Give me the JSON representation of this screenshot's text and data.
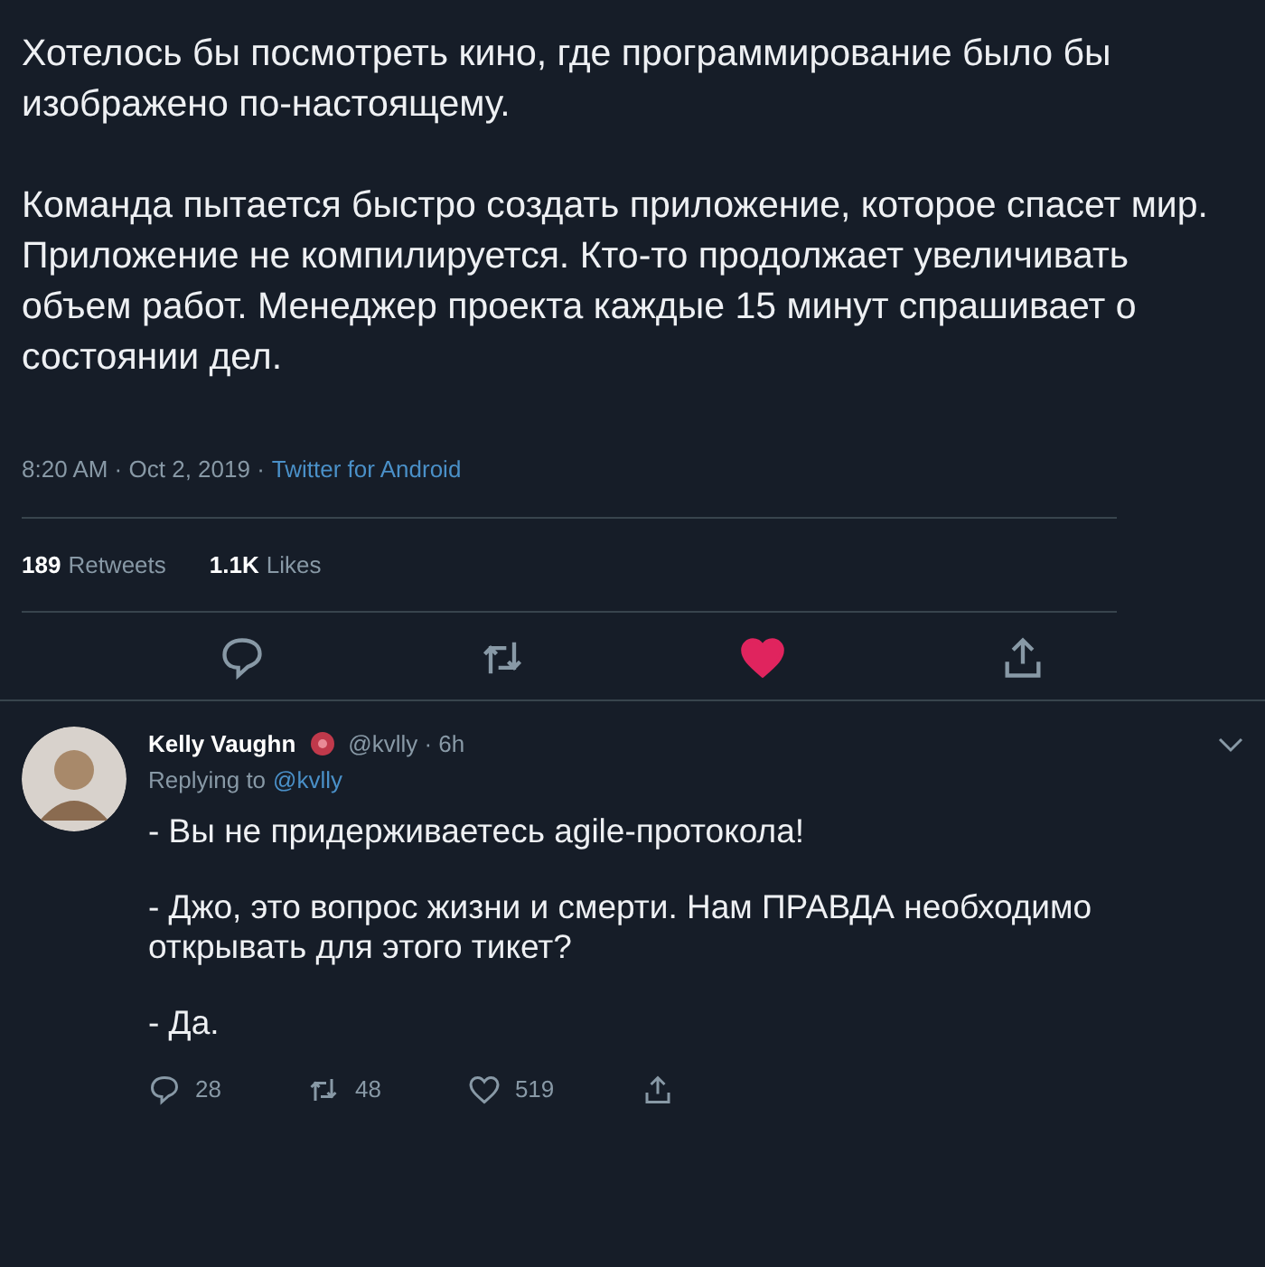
{
  "tweet": {
    "paragraphs": [
      "Хотелось бы посмотреть кино, где программирование было бы изображено по-настоящему.",
      "Команда пытается быстро создать приложение, которое спасет мир. Приложение не компилируется. Кто-то продолжает увеличивать объем работ. Менеджер проекта каждые 15 минут спрашивает о состоянии дел."
    ],
    "timestamp": "8:20 AM · Oct 2, 2019 ·",
    "source": "Twitter for Android",
    "stats": [
      {
        "count": "189",
        "label": "Retweets"
      },
      {
        "count": "1.1K",
        "label": "Likes"
      }
    ],
    "liked": true
  },
  "reply": {
    "name": "Kelly Vaughn",
    "handle": "@kvlly · 6h",
    "replying_prefix": "Replying to",
    "replying_to": "@kvlly",
    "paragraphs": [
      "- Вы не придерживаетесь agile-протокола!",
      "- Джо, это вопрос жизни и смерти. Нам ПРАВДА необходимо открывать для этого тикет?",
      "- Да."
    ],
    "reply_count": "28",
    "retweet_count": "48",
    "like_count": "519",
    "liked": false
  }
}
